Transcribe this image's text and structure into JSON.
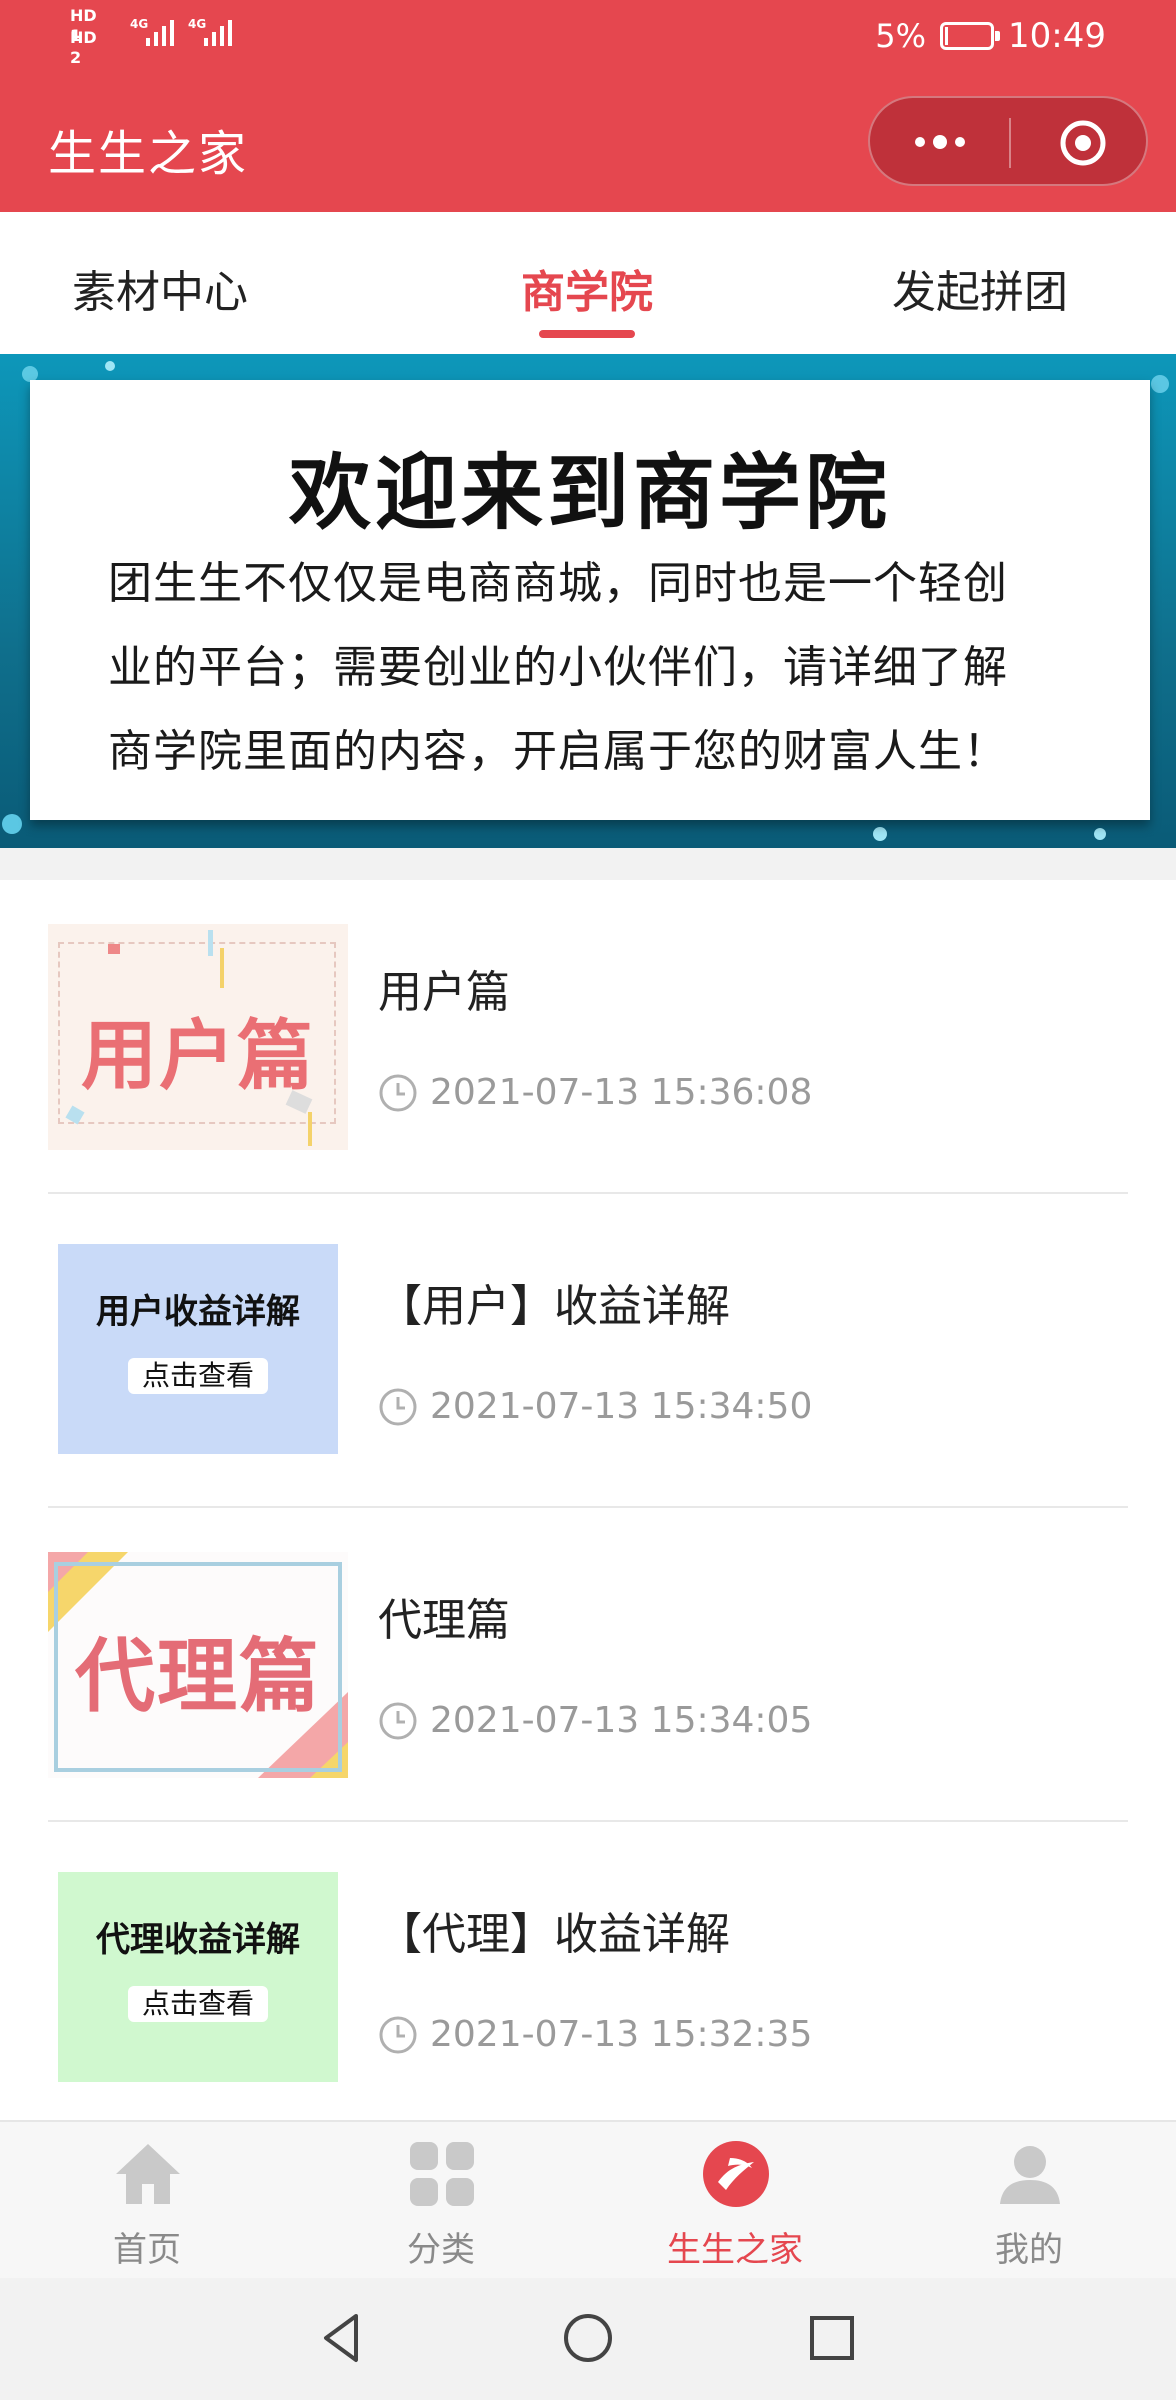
{
  "status_bar": {
    "sim1": "HD 1",
    "sim2": "HD 2",
    "net1": "4G",
    "net2": "4G",
    "battery": "5%",
    "battery_level": 0.05,
    "time": "10:49"
  },
  "nav": {
    "title": "生生之家",
    "menu_icon": "more-dots-icon",
    "close_icon": "target-close-icon"
  },
  "tabs": [
    {
      "label": "素材中心",
      "active": false
    },
    {
      "label": "商学院",
      "active": true
    },
    {
      "label": "发起拼团",
      "active": false
    }
  ],
  "banner": {
    "title": "欢迎来到商学院",
    "lines": [
      "团生生不仅仅是电商商城，同时也是一个轻创",
      "业的平台；需要创业的小伙伴们，请详细了解",
      "商学院里面的内容，开启属于您的财富人生！"
    ]
  },
  "articles": [
    {
      "thumb_text": "用户篇",
      "title": "用户篇",
      "time": "2021-07-13 15:36:08"
    },
    {
      "thumb_text": "用户收益详解",
      "thumb_button": "点击查看",
      "title": "【用户】收益详解",
      "time": "2021-07-13 15:34:50"
    },
    {
      "thumb_text": "代理篇",
      "title": "代理篇",
      "time": "2021-07-13 15:34:05"
    },
    {
      "thumb_text": "代理收益详解",
      "thumb_button": "点击查看",
      "title": "【代理】收益详解",
      "time": "2021-07-13 15:32:35"
    }
  ],
  "tabbar": [
    {
      "label": "首页",
      "icon": "home-icon",
      "active": false
    },
    {
      "label": "分类",
      "icon": "grid-icon",
      "active": false
    },
    {
      "label": "生生之家",
      "icon": "brand-logo-icon",
      "active": true
    },
    {
      "label": "我的",
      "icon": "user-icon",
      "active": false
    }
  ],
  "colors": {
    "accent": "#e5474f",
    "muted": "#8a8a8a",
    "banner_bg": "#0b8fb0"
  }
}
